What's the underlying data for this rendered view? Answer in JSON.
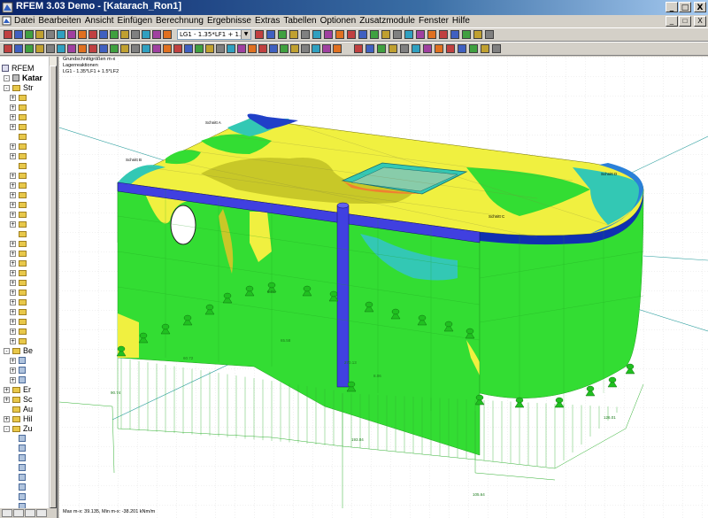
{
  "window": {
    "title": "RFEM 3.03 Demo - [Katarach_Ron1]",
    "min_label": "_",
    "max_label": "□",
    "close_label": "X"
  },
  "menu": {
    "items": [
      "Datei",
      "Bearbeiten",
      "Ansicht",
      "Einfügen",
      "Berechnung",
      "Ergebnisse",
      "Extras",
      "Tabellen",
      "Optionen",
      "Zusatzmodule",
      "Fenster",
      "Hilfe"
    ],
    "doc_min_label": "_",
    "doc_restore_label": "□",
    "doc_close_label": "X"
  },
  "toolbar": {
    "load_case": "LG1 - 1.35*LF1 + 1.5*LF2"
  },
  "navigator": {
    "root": "RFEM",
    "project": "Katar",
    "nodes": [
      {
        "label": "Str",
        "indent": 2,
        "type": "folder",
        "exp": "-"
      },
      {
        "label": "",
        "indent": 3,
        "type": "folder",
        "exp": "+"
      },
      {
        "label": "",
        "indent": 3,
        "type": "folder",
        "exp": "+"
      },
      {
        "label": "",
        "indent": 3,
        "type": "folder",
        "exp": "+"
      },
      {
        "label": "",
        "indent": 3,
        "type": "folder",
        "exp": "+"
      },
      {
        "label": "",
        "indent": 3,
        "type": "folder",
        "exp": ""
      },
      {
        "label": "",
        "indent": 3,
        "type": "folder",
        "exp": "+"
      },
      {
        "label": "",
        "indent": 3,
        "type": "folder",
        "exp": "+"
      },
      {
        "label": "",
        "indent": 3,
        "type": "folder",
        "exp": ""
      },
      {
        "label": "",
        "indent": 3,
        "type": "folder",
        "exp": "+"
      },
      {
        "label": "",
        "indent": 3,
        "type": "folder",
        "exp": "+"
      },
      {
        "label": "",
        "indent": 3,
        "type": "folder",
        "exp": "+"
      },
      {
        "label": "",
        "indent": 3,
        "type": "folder",
        "exp": "+"
      },
      {
        "label": "",
        "indent": 3,
        "type": "folder",
        "exp": "+"
      },
      {
        "label": "",
        "indent": 3,
        "type": "folder",
        "exp": "+"
      },
      {
        "label": "",
        "indent": 3,
        "type": "folder",
        "exp": ""
      },
      {
        "label": "",
        "indent": 3,
        "type": "folder",
        "exp": "+"
      },
      {
        "label": "",
        "indent": 3,
        "type": "folder",
        "exp": "+"
      },
      {
        "label": "",
        "indent": 3,
        "type": "folder",
        "exp": "+"
      },
      {
        "label": "",
        "indent": 3,
        "type": "folder",
        "exp": "+"
      },
      {
        "label": "",
        "indent": 3,
        "type": "folder",
        "exp": "+"
      },
      {
        "label": "",
        "indent": 3,
        "type": "folder",
        "exp": "+"
      },
      {
        "label": "",
        "indent": 3,
        "type": "folder",
        "exp": "+"
      },
      {
        "label": "",
        "indent": 3,
        "type": "folder",
        "exp": "+"
      },
      {
        "label": "",
        "indent": 3,
        "type": "folder",
        "exp": "+"
      },
      {
        "label": "",
        "indent": 3,
        "type": "folder",
        "exp": "+"
      },
      {
        "label": "",
        "indent": 3,
        "type": "folder",
        "exp": "+"
      },
      {
        "label": "Be",
        "indent": 2,
        "type": "folder",
        "exp": "-"
      },
      {
        "label": "",
        "indent": 3,
        "type": "doc",
        "exp": "+"
      },
      {
        "label": "",
        "indent": 3,
        "type": "doc",
        "exp": "+"
      },
      {
        "label": "",
        "indent": 3,
        "type": "doc",
        "exp": "+"
      },
      {
        "label": "Er",
        "indent": 2,
        "type": "folder",
        "exp": "+"
      },
      {
        "label": "Sc",
        "indent": 2,
        "type": "folder",
        "exp": "+"
      },
      {
        "label": "Au",
        "indent": 2,
        "type": "folder",
        "exp": ""
      },
      {
        "label": "Hil",
        "indent": 2,
        "type": "folder",
        "exp": "+"
      },
      {
        "label": "Zu",
        "indent": 2,
        "type": "folder",
        "exp": "-"
      },
      {
        "label": "",
        "indent": 3,
        "type": "doc",
        "exp": ""
      },
      {
        "label": "",
        "indent": 3,
        "type": "doc",
        "exp": ""
      },
      {
        "label": "",
        "indent": 3,
        "type": "doc",
        "exp": ""
      },
      {
        "label": "",
        "indent": 3,
        "type": "doc",
        "exp": ""
      },
      {
        "label": "",
        "indent": 3,
        "type": "doc",
        "exp": ""
      },
      {
        "label": "",
        "indent": 3,
        "type": "doc",
        "exp": ""
      },
      {
        "label": "",
        "indent": 3,
        "type": "doc",
        "exp": ""
      },
      {
        "label": "",
        "indent": 3,
        "type": "doc",
        "exp": ""
      },
      {
        "label": "",
        "indent": 3,
        "type": "doc",
        "exp": ""
      },
      {
        "label": "",
        "indent": 3,
        "type": "doc",
        "exp": ""
      }
    ]
  },
  "view": {
    "info_line1": "Grundschnittgrößen m-x",
    "info_line2": "Lagerreaktionen",
    "info_line3": "LG1 - 1.35*LF1 + 1.5*LF2",
    "maxmin": "Max m-x: 39.135, Min m-x: -38.201 kNm/m",
    "values": {
      "v1": "60.72",
      "v2": "65.58",
      "v3": "90.74",
      "v4": "270.13",
      "v5": "8.06",
      "v6": "193.04",
      "v7": "126.01",
      "v8": "105.64",
      "v9": "8.01"
    },
    "section_labels": [
      "Schnitt A",
      "Schnitt B",
      "Schnitt C",
      "Schnitt D"
    ],
    "colors": {
      "green": "#33dd33",
      "yellow": "#f0f040",
      "olive": "#c8c828",
      "cyan": "#33c8b4",
      "blue": "#2040c8",
      "darkblue": "#0020a0",
      "beam": "#4040e0"
    }
  }
}
